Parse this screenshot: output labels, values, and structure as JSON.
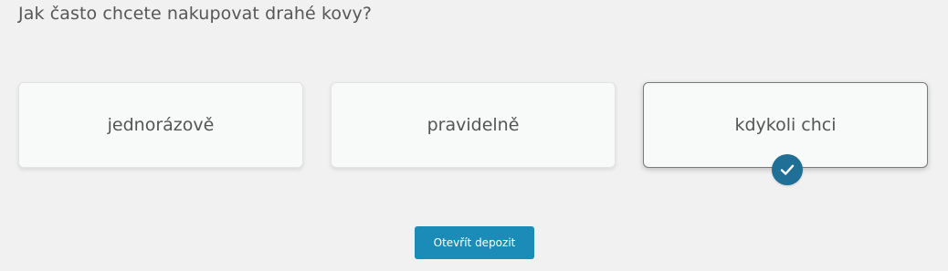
{
  "question": "Jak často chcete nakupovat drahé kovy?",
  "options": [
    {
      "label": "jednorázově",
      "selected": false
    },
    {
      "label": "pravidelně",
      "selected": false
    },
    {
      "label": "kdykoli chci",
      "selected": true
    }
  ],
  "selected_indicator_icon": "checkmark-icon",
  "cta": {
    "label": "Otevřít depozit"
  },
  "colors": {
    "background": "#f1f1f1",
    "card": "#f8f9f9",
    "selected_border": "#7a7a7a",
    "check_badge": "#1f6f96",
    "button": "#1a8cb7",
    "text": "#555555"
  }
}
